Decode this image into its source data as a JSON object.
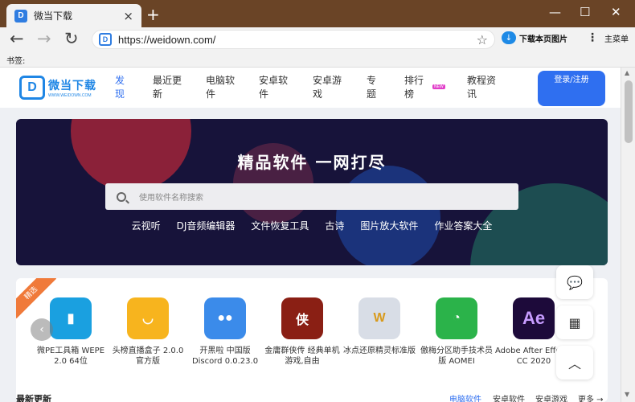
{
  "browser": {
    "tab_title": "微当下载",
    "tab_close": "×",
    "new_tab": "+",
    "win_min": "—",
    "win_max": "☐",
    "win_close": "✕",
    "back": "←",
    "forward": "→",
    "reload": "↻",
    "url": "https://weidown.com/",
    "star": "☆",
    "download_label": "下载本页图片",
    "menu_label": "主菜单",
    "bookmarks_label": "书签:"
  },
  "site": {
    "logo_mark": "D",
    "logo_cn": "微当下载",
    "logo_en": "WWW.WEIDOWN.COM",
    "nav": [
      {
        "label": "发现",
        "active": true
      },
      {
        "label": "最近更新"
      },
      {
        "label": "电脑软件"
      },
      {
        "label": "安卓软件"
      },
      {
        "label": "安卓游戏"
      },
      {
        "label": "专题"
      },
      {
        "label": "排行榜"
      },
      {
        "label": "教程资讯"
      }
    ],
    "new_badge": "NEW",
    "login": "登录/注册"
  },
  "hero": {
    "title": "精品软件 一网打尽",
    "search_placeholder": "使用软件名称搜索",
    "hot": [
      "云视听",
      "DJ音频编辑器",
      "文件恢复工具",
      "古诗",
      "图片放大软件",
      "作业答案大全"
    ]
  },
  "featured": {
    "ribbon": "精选",
    "prev": "‹",
    "apps": [
      {
        "name": "微PE工具箱 WEPE 2.0 64位",
        "icon": "usb-drive-icon",
        "color": "#1aa0e0",
        "glyph": "▮"
      },
      {
        "name": "头榜直播盒子 2.0.0 官方版",
        "icon": "smile-face-icon",
        "color": "#f7b41e",
        "glyph": "◡"
      },
      {
        "name": "开黑啦 中国版 Discord 0.0.23.0",
        "icon": "chat-bubble-icon",
        "color": "#3b8bea",
        "glyph": "●●"
      },
      {
        "name": "金庸群侠传 经典单机游戏,自由",
        "icon": "game-cover-icon",
        "color": "#8a1f14",
        "glyph": "侠"
      },
      {
        "name": "冰点还原精灵标准版",
        "icon": "polar-bear-icon",
        "color": "#d8dde6",
        "glyph": "W"
      },
      {
        "name": "傲梅分区助手技术员版 AOMEI",
        "icon": "pie-partition-icon",
        "color": "#2bb34a",
        "glyph": "◔"
      },
      {
        "name": "Adobe After Effects CC 2020",
        "icon": "after-effects-icon",
        "color": "#1d0a3a",
        "glyph": "Ae"
      }
    ]
  },
  "float": {
    "chat": "💬",
    "qr": "▦",
    "top": "︿"
  },
  "latest": {
    "title": "最新更新",
    "tabs": [
      "电脑软件",
      "安卓软件",
      "安卓游戏",
      "更多 →"
    ]
  }
}
